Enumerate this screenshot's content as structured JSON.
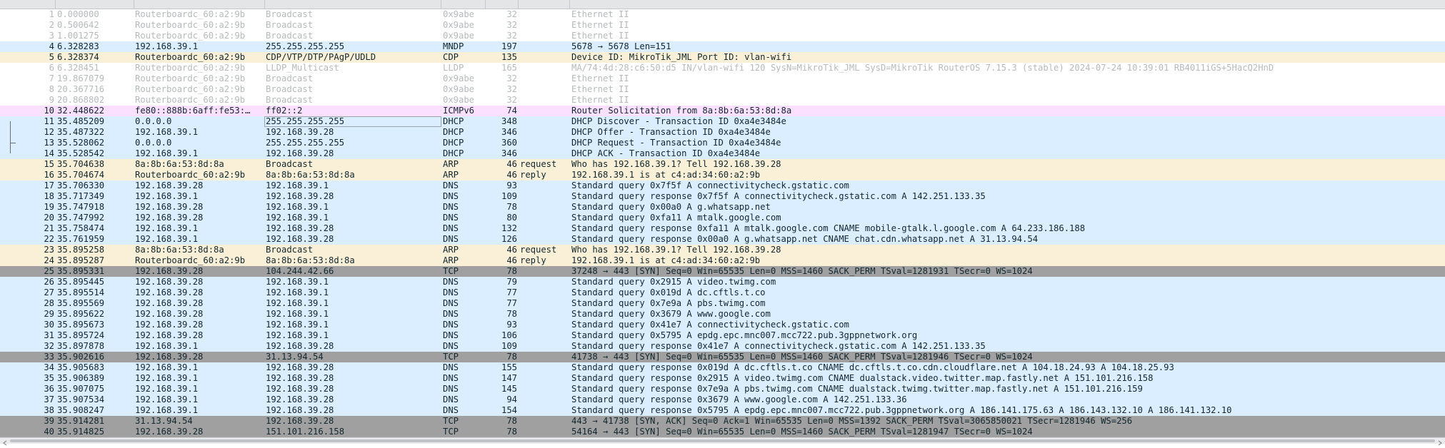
{
  "colors": {
    "white": "#ffffff",
    "udp_blue": "#daeeff",
    "arp_tan": "#faf0d7",
    "icmpv6_pink": "#fce0ff",
    "tcp_syn_gray": "#a0a0a0",
    "dim_text": "#b6b9bb",
    "normal_text": "#12272e"
  },
  "packets": [
    {
      "no": "1",
      "time": "0.000000",
      "src": "Routerboardc_60:a2:9b",
      "dst": "Broadcast",
      "proto": "0x9abe",
      "len": "32",
      "extra": "",
      "info": "Ethernet II",
      "style": "dim"
    },
    {
      "no": "2",
      "time": "0.500642",
      "src": "Routerboardc_60:a2:9b",
      "dst": "Broadcast",
      "proto": "0x9abe",
      "len": "32",
      "extra": "",
      "info": "Ethernet II",
      "style": "dim"
    },
    {
      "no": "3",
      "time": "1.001275",
      "src": "Routerboardc_60:a2:9b",
      "dst": "Broadcast",
      "proto": "0x9abe",
      "len": "32",
      "extra": "",
      "info": "Ethernet II",
      "style": "dim"
    },
    {
      "no": "4",
      "time": "6.328283",
      "src": "192.168.39.1",
      "dst": "255.255.255.255",
      "proto": "MNDP",
      "len": "197",
      "extra": "",
      "info": "5678 → 5678 Len=151",
      "style": "udp"
    },
    {
      "no": "5",
      "time": "6.328374",
      "src": "Routerboardc_60:a2:9b",
      "dst": "CDP/VTP/DTP/PAgP/UDLD",
      "proto": "CDP",
      "len": "135",
      "extra": "",
      "info": "Device ID: MikroTik_JML  Port ID: vlan-wifi",
      "style": "arp"
    },
    {
      "no": "6",
      "time": "6.328451",
      "src": "Routerboardc_60:a2:9b",
      "dst": "LLDP_Multicast",
      "proto": "LLDP",
      "len": "165",
      "extra": "",
      "info": "MA/74:4d:28:c6:50:d5 IN/vlan-wifi 120 SysN=MikroTik_JML SysD=MikroTik RouterOS 7.15.3 (stable) 2024-07-24 10:39:01 RB4011iGS+5HacQ2HnD",
      "style": "dim"
    },
    {
      "no": "7",
      "time": "19.867079",
      "src": "Routerboardc_60:a2:9b",
      "dst": "Broadcast",
      "proto": "0x9abe",
      "len": "32",
      "extra": "",
      "info": "Ethernet II",
      "style": "dim"
    },
    {
      "no": "8",
      "time": "20.367716",
      "src": "Routerboardc_60:a2:9b",
      "dst": "Broadcast",
      "proto": "0x9abe",
      "len": "32",
      "extra": "",
      "info": "Ethernet II",
      "style": "dim"
    },
    {
      "no": "9",
      "time": "20.868802",
      "src": "Routerboardc_60:a2:9b",
      "dst": "Broadcast",
      "proto": "0x9abe",
      "len": "32",
      "extra": "",
      "info": "Ethernet II",
      "style": "dim"
    },
    {
      "no": "10",
      "time": "32.448622",
      "src": "fe80::888b:6aff:fe53:…",
      "dst": "ff02::2",
      "proto": "ICMPv6",
      "len": "74",
      "extra": "",
      "info": "Router Solicitation from 8a:8b:6a:53:8d:8a",
      "style": "icmp"
    },
    {
      "no": "11",
      "time": "35.485209",
      "src": "0.0.0.0",
      "dst": "255.255.255.255",
      "proto": "DHCP",
      "len": "348",
      "extra": "",
      "info": "DHCP Discover - Transaction ID 0xa4e3484e",
      "style": "udp"
    },
    {
      "no": "12",
      "time": "35.487322",
      "src": "192.168.39.1",
      "dst": "192.168.39.28",
      "proto": "DHCP",
      "len": "346",
      "extra": "",
      "info": "DHCP Offer    - Transaction ID 0xa4e3484e",
      "style": "udp"
    },
    {
      "no": "13",
      "time": "35.528062",
      "src": "0.0.0.0",
      "dst": "255.255.255.255",
      "proto": "DHCP",
      "len": "360",
      "extra": "",
      "info": "DHCP Request  - Transaction ID 0xa4e3484e",
      "style": "udp"
    },
    {
      "no": "14",
      "time": "35.528542",
      "src": "192.168.39.1",
      "dst": "192.168.39.28",
      "proto": "DHCP",
      "len": "346",
      "extra": "",
      "info": "DHCP ACK      - Transaction ID 0xa4e3484e",
      "style": "udp"
    },
    {
      "no": "15",
      "time": "35.704638",
      "src": "8a:8b:6a:53:8d:8a",
      "dst": "Broadcast",
      "proto": "ARP",
      "len": "46",
      "extra": "request",
      "info": "Who has 192.168.39.1? Tell 192.168.39.28",
      "style": "arp"
    },
    {
      "no": "16",
      "time": "35.704674",
      "src": "Routerboardc_60:a2:9b",
      "dst": "8a:8b:6a:53:8d:8a",
      "proto": "ARP",
      "len": "46",
      "extra": "reply",
      "info": "192.168.39.1 is at c4:ad:34:60:a2:9b",
      "style": "arp"
    },
    {
      "no": "17",
      "time": "35.706330",
      "src": "192.168.39.28",
      "dst": "192.168.39.1",
      "proto": "DNS",
      "len": "93",
      "extra": "",
      "info": "Standard query 0x7f5f A connectivitycheck.gstatic.com",
      "style": "udp"
    },
    {
      "no": "18",
      "time": "35.717349",
      "src": "192.168.39.1",
      "dst": "192.168.39.28",
      "proto": "DNS",
      "len": "109",
      "extra": "",
      "info": "Standard query response 0x7f5f A connectivitycheck.gstatic.com A 142.251.133.35",
      "style": "udp"
    },
    {
      "no": "19",
      "time": "35.747918",
      "src": "192.168.39.28",
      "dst": "192.168.39.1",
      "proto": "DNS",
      "len": "78",
      "extra": "",
      "info": "Standard query 0x00a0 A g.whatsapp.net",
      "style": "udp"
    },
    {
      "no": "20",
      "time": "35.747992",
      "src": "192.168.39.28",
      "dst": "192.168.39.1",
      "proto": "DNS",
      "len": "80",
      "extra": "",
      "info": "Standard query 0xfa11 A mtalk.google.com",
      "style": "udp"
    },
    {
      "no": "21",
      "time": "35.758474",
      "src": "192.168.39.1",
      "dst": "192.168.39.28",
      "proto": "DNS",
      "len": "132",
      "extra": "",
      "info": "Standard query response 0xfa11 A mtalk.google.com CNAME mobile-gtalk.l.google.com A 64.233.186.188",
      "style": "udp"
    },
    {
      "no": "22",
      "time": "35.761959",
      "src": "192.168.39.1",
      "dst": "192.168.39.28",
      "proto": "DNS",
      "len": "126",
      "extra": "",
      "info": "Standard query response 0x00a0 A g.whatsapp.net CNAME chat.cdn.whatsapp.net A 31.13.94.54",
      "style": "udp"
    },
    {
      "no": "23",
      "time": "35.895258",
      "src": "8a:8b:6a:53:8d:8a",
      "dst": "Broadcast",
      "proto": "ARP",
      "len": "46",
      "extra": "request",
      "info": "Who has 192.168.39.1? Tell 192.168.39.28",
      "style": "arp"
    },
    {
      "no": "24",
      "time": "35.895287",
      "src": "Routerboardc_60:a2:9b",
      "dst": "8a:8b:6a:53:8d:8a",
      "proto": "ARP",
      "len": "46",
      "extra": "reply",
      "info": "192.168.39.1 is at c4:ad:34:60:a2:9b",
      "style": "arp"
    },
    {
      "no": "25",
      "time": "35.895331",
      "src": "192.168.39.28",
      "dst": "104.244.42.66",
      "proto": "TCP",
      "len": "78",
      "extra": "",
      "info": "37248 → 443 [SYN] Seq=0 Win=65535 Len=0 MSS=1460 SACK_PERM TSval=1281931 TSecr=0 WS=1024",
      "style": "tcp"
    },
    {
      "no": "26",
      "time": "35.895445",
      "src": "192.168.39.28",
      "dst": "192.168.39.1",
      "proto": "DNS",
      "len": "79",
      "extra": "",
      "info": "Standard query 0x2915 A video.twimg.com",
      "style": "udp"
    },
    {
      "no": "27",
      "time": "35.895514",
      "src": "192.168.39.28",
      "dst": "192.168.39.1",
      "proto": "DNS",
      "len": "77",
      "extra": "",
      "info": "Standard query 0x019d A dc.cftls.t.co",
      "style": "udp"
    },
    {
      "no": "28",
      "time": "35.895569",
      "src": "192.168.39.28",
      "dst": "192.168.39.1",
      "proto": "DNS",
      "len": "77",
      "extra": "",
      "info": "Standard query 0x7e9a A pbs.twimg.com",
      "style": "udp"
    },
    {
      "no": "29",
      "time": "35.895622",
      "src": "192.168.39.28",
      "dst": "192.168.39.1",
      "proto": "DNS",
      "len": "78",
      "extra": "",
      "info": "Standard query 0x3679 A www.google.com",
      "style": "udp"
    },
    {
      "no": "30",
      "time": "35.895673",
      "src": "192.168.39.28",
      "dst": "192.168.39.1",
      "proto": "DNS",
      "len": "93",
      "extra": "",
      "info": "Standard query 0x41e7 A connectivitycheck.gstatic.com",
      "style": "udp"
    },
    {
      "no": "31",
      "time": "35.895724",
      "src": "192.168.39.28",
      "dst": "192.168.39.1",
      "proto": "DNS",
      "len": "106",
      "extra": "",
      "info": "Standard query 0x5795 A epdg.epc.mnc007.mcc722.pub.3gppnetwork.org",
      "style": "udp"
    },
    {
      "no": "32",
      "time": "35.897878",
      "src": "192.168.39.1",
      "dst": "192.168.39.28",
      "proto": "DNS",
      "len": "109",
      "extra": "",
      "info": "Standard query response 0x41e7 A connectivitycheck.gstatic.com A 142.251.133.35",
      "style": "udp"
    },
    {
      "no": "33",
      "time": "35.902616",
      "src": "192.168.39.28",
      "dst": "31.13.94.54",
      "proto": "TCP",
      "len": "78",
      "extra": "",
      "info": "41738 → 443 [SYN] Seq=0 Win=65535 Len=0 MSS=1460 SACK_PERM TSval=1281946 TSecr=0 WS=1024",
      "style": "tcp"
    },
    {
      "no": "34",
      "time": "35.905683",
      "src": "192.168.39.1",
      "dst": "192.168.39.28",
      "proto": "DNS",
      "len": "155",
      "extra": "",
      "info": "Standard query response 0x019d A dc.cftls.t.co CNAME dc.cftls.t.co.cdn.cloudflare.net A 104.18.24.93 A 104.18.25.93",
      "style": "udp"
    },
    {
      "no": "35",
      "time": "35.906389",
      "src": "192.168.39.1",
      "dst": "192.168.39.28",
      "proto": "DNS",
      "len": "147",
      "extra": "",
      "info": "Standard query response 0x2915 A video.twimg.com CNAME dualstack.video.twitter.map.fastly.net A 151.101.216.158",
      "style": "udp"
    },
    {
      "no": "36",
      "time": "35.907075",
      "src": "192.168.39.1",
      "dst": "192.168.39.28",
      "proto": "DNS",
      "len": "145",
      "extra": "",
      "info": "Standard query response 0x7e9a A pbs.twimg.com CNAME dualstack.twimg.twitter.map.fastly.net A 151.101.216.159",
      "style": "udp"
    },
    {
      "no": "37",
      "time": "35.907534",
      "src": "192.168.39.1",
      "dst": "192.168.39.28",
      "proto": "DNS",
      "len": "94",
      "extra": "",
      "info": "Standard query response 0x3679 A www.google.com A 142.251.133.36",
      "style": "udp"
    },
    {
      "no": "38",
      "time": "35.908247",
      "src": "192.168.39.1",
      "dst": "192.168.39.28",
      "proto": "DNS",
      "len": "154",
      "extra": "",
      "info": "Standard query response 0x5795 A epdg.epc.mnc007.mcc722.pub.3gppnetwork.org A 186.141.175.63 A 186.143.132.10 A 186.141.132.10",
      "style": "udp"
    },
    {
      "no": "39",
      "time": "35.914281",
      "src": "31.13.94.54",
      "dst": "192.168.39.28",
      "proto": "TCP",
      "len": "78",
      "extra": "",
      "info": "443 → 41738 [SYN, ACK] Seq=0 Ack=1 Win=65535 Len=0 MSS=1392 SACK_PERM TSval=3065850021 TSecr=1281946 WS=256",
      "style": "tcp"
    },
    {
      "no": "40",
      "time": "35.914825",
      "src": "192.168.39.28",
      "dst": "151.101.216.158",
      "proto": "TCP",
      "len": "78",
      "extra": "",
      "info": "54164 → 443 [SYN] Seq=0 Win=65535 Len=0 MSS=1460 SACK_PERM TSval=1281947 TSecr=0 WS=1024",
      "style": "tcp"
    }
  ]
}
